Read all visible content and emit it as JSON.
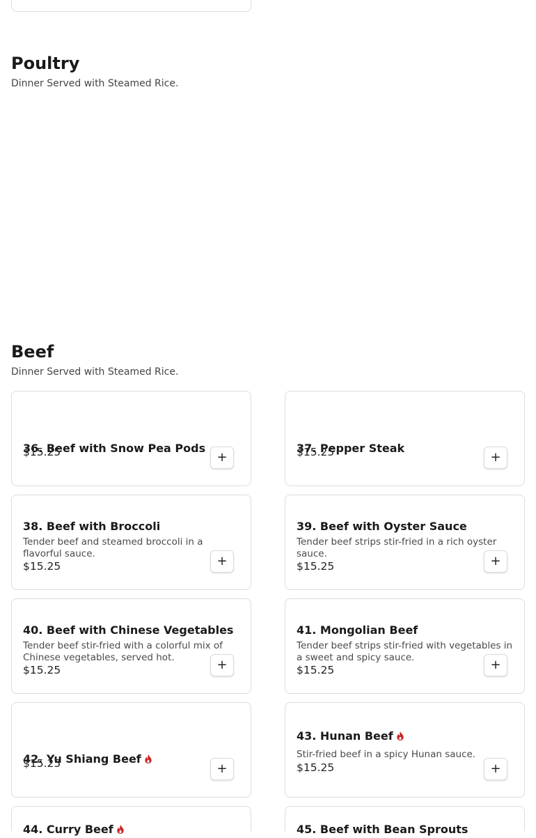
{
  "sections": {
    "poultry": {
      "title": "Poultry",
      "subtitle": "Dinner Served with Steamed Rice."
    },
    "beef": {
      "title": "Beef",
      "subtitle": "Dinner Served with Steamed Rice."
    }
  },
  "add_label": "+",
  "accent_colors": {
    "spicy": "#c62828"
  },
  "icons": {
    "add": "plus-icon",
    "spicy": "flame-icon"
  },
  "items": [
    {
      "name": "36. Beef with Snow Pea Pods",
      "description": "",
      "price": "$15.25",
      "spicy": false
    },
    {
      "name": "37. Pepper Steak",
      "description": "",
      "price": "$15.25",
      "spicy": false
    },
    {
      "name": "38. Beef with Broccoli",
      "description": "Tender beef and steamed broccoli in a flavorful sauce.",
      "price": "$15.25",
      "spicy": false
    },
    {
      "name": "39. Beef with Oyster Sauce",
      "description": "Tender beef strips stir-fried in a rich oyster sauce.",
      "price": "$15.25",
      "spicy": false
    },
    {
      "name": "40. Beef with Chinese Vegetables",
      "description": "Tender beef stir-fried with a colorful mix of Chinese vegetables, served hot.",
      "price": "$15.25",
      "spicy": false
    },
    {
      "name": "41. Mongolian Beef",
      "description": "Tender beef strips stir-fried with vegetables in a sweet and spicy sauce.",
      "price": "$15.25",
      "spicy": false
    },
    {
      "name": "42. Yu Shiang Beef",
      "description": "",
      "price": "$15.25",
      "spicy": true
    },
    {
      "name": "43. Hunan Beef",
      "description": "Stir-fried beef in a spicy Hunan sauce.",
      "price": "$15.25",
      "spicy": true
    },
    {
      "name": "44. Curry Beef",
      "description": "",
      "price": "",
      "spicy": true
    },
    {
      "name": "45. Beef with Bean Sprouts",
      "description": "",
      "price": "",
      "spicy": false
    }
  ]
}
